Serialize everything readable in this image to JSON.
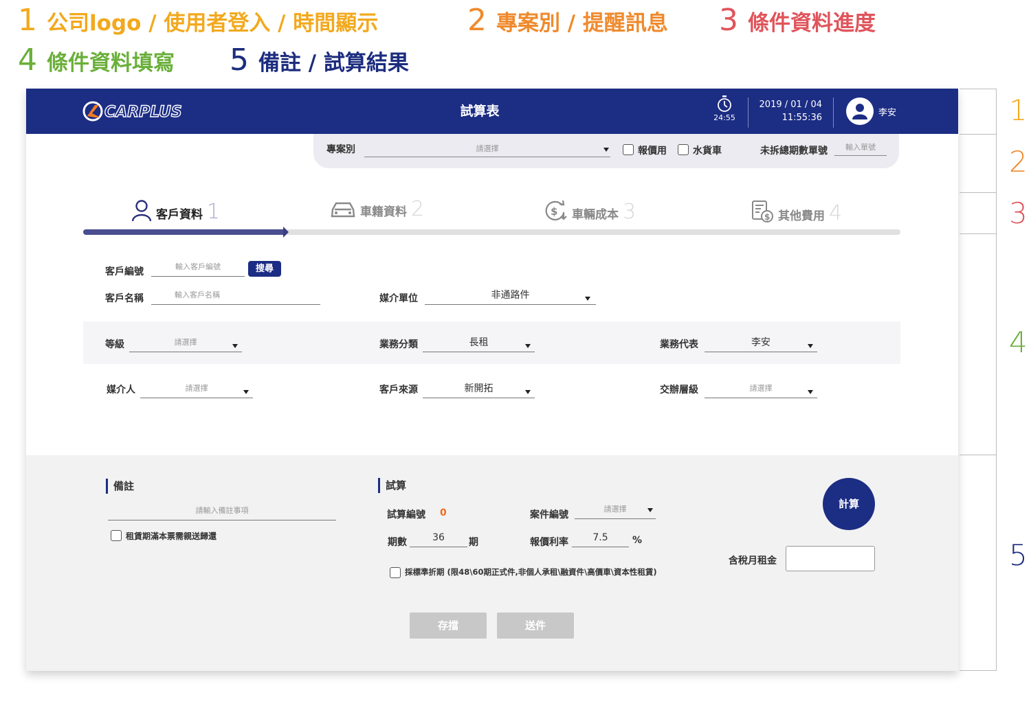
{
  "legend": [
    {
      "num": "1",
      "text": "公司logo / 使用者登入 / 時間顯示",
      "color": "#f2a91e"
    },
    {
      "num": "2",
      "text": "專案別 / 提醒訊息",
      "color": "#ef8a2c"
    },
    {
      "num": "3",
      "text": "條件資料進度",
      "color": "#e0545b"
    },
    {
      "num": "4",
      "text": "條件資料填寫",
      "color": "#6aaf3a"
    },
    {
      "num": "5",
      "text": "備註 / 試算結果",
      "color": "#1c2c7e"
    }
  ],
  "header": {
    "logo_text": "CARPLUS",
    "title": "試算表",
    "timer": "24:55",
    "date": "2019 / 01 / 04",
    "time": "11:55:36",
    "user": "李安",
    "bg_color": "#1c2d84"
  },
  "project_bar": {
    "project_label": "專案別",
    "project_placeholder": "請選擇",
    "checkbox_quote": "報價用",
    "checkbox_water": "水貨車",
    "unsplit_label": "未拆總期數單號",
    "unsplit_placeholder": "輸入單號"
  },
  "steps": [
    {
      "label": "客戶資料",
      "num": "1",
      "active": true,
      "icon": "user-icon"
    },
    {
      "label": "車籍資料",
      "num": "2",
      "active": false,
      "icon": "car-icon"
    },
    {
      "label": "車輛成本",
      "num": "3",
      "active": false,
      "icon": "dollar-cycle-icon"
    },
    {
      "label": "其他費用",
      "num": "4",
      "active": false,
      "icon": "invoice-icon"
    }
  ],
  "progress": {
    "fraction": 0.245,
    "accent": "#4a4d8f"
  },
  "form": {
    "customer_no_label": "客戶編號",
    "customer_no_placeholder": "輸入客戶編號",
    "search_label": "搜尋",
    "customer_name_label": "客戶名稱",
    "customer_name_placeholder": "輸入客戶名稱",
    "media_unit_label": "媒介單位",
    "media_unit_value": "非通路件",
    "grade_label": "等級",
    "grade_value": "請選擇",
    "biz_category_label": "業務分類",
    "biz_category_value": "長租",
    "biz_rep_label": "業務代表",
    "biz_rep_value": "李安",
    "intermediary_label": "媒介人",
    "intermediary_value": "請選擇",
    "source_label": "客戶來源",
    "source_value": "新開拓",
    "handling_level_label": "交辦層級",
    "handling_level_value": "請選擇"
  },
  "notes": {
    "title": "備註",
    "placeholder": "請輸入備註事項",
    "checkbox_label": "租賃期滿本票需親送歸還"
  },
  "calc": {
    "title": "試算",
    "calc_no_label": "試算編號",
    "calc_no_value": "0",
    "case_no_label": "案件編號",
    "case_no_value": "請選擇",
    "periods_label": "期數",
    "periods_value": "36",
    "periods_unit": "期",
    "rate_label": "報價利率",
    "rate_value": "7.5",
    "rate_unit": "%",
    "standard_checkbox_label": "採標準折期 (限48\\60期正式件,非個人承租\\融資件\\高價車\\資本性租賃)",
    "calc_button": "計算",
    "monthly_rent_label": "含稅月租金",
    "save_button": "存擋",
    "send_button": "送件"
  },
  "side_markers": [
    {
      "num": "1",
      "color": "#f2a91e"
    },
    {
      "num": "2",
      "color": "#ef8a2c"
    },
    {
      "num": "3",
      "color": "#e0545b"
    },
    {
      "num": "4",
      "color": "#6aaf3a"
    },
    {
      "num": "5",
      "color": "#1c2c7e"
    }
  ]
}
